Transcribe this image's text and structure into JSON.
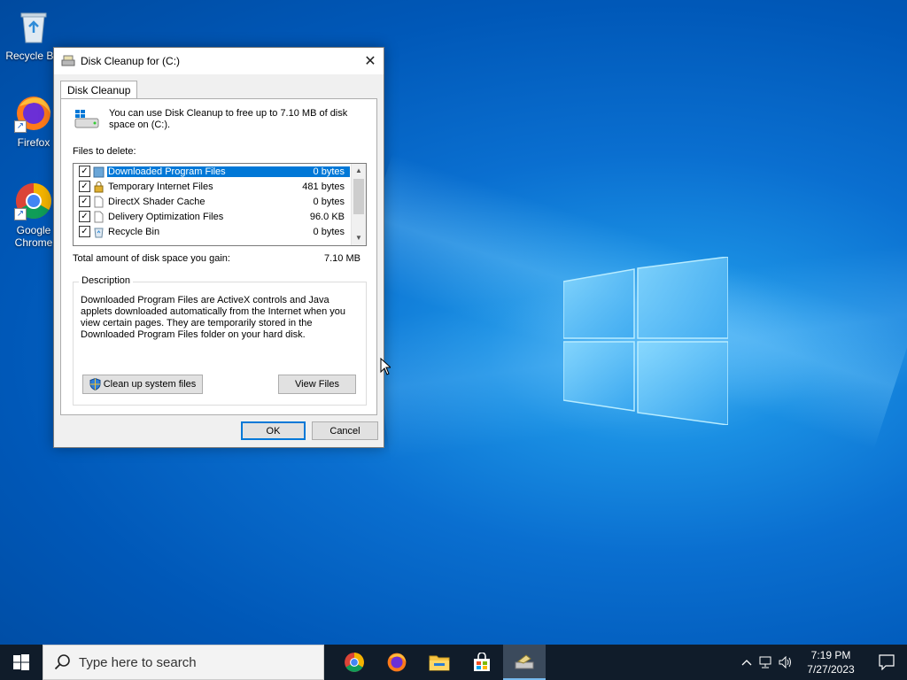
{
  "desktop": {
    "icons": [
      {
        "label": "Recycle Bin",
        "icon": "recycle-bin-icon"
      },
      {
        "label": "Firefox",
        "icon": "firefox-icon"
      },
      {
        "label": "Google Chrome",
        "icon": "chrome-icon"
      }
    ]
  },
  "dialog": {
    "title": "Disk Cleanup for  (C:)",
    "tab_label": "Disk Cleanup",
    "info_text": "You can use Disk Cleanup to free up to 7.10 MB of disk space on  (C:).",
    "files_label": "Files to delete:",
    "files": [
      {
        "name": "Downloaded Program Files",
        "size": "0 bytes",
        "checked": true,
        "selected": true
      },
      {
        "name": "Temporary Internet Files",
        "size": "481 bytes",
        "checked": true,
        "selected": false
      },
      {
        "name": "DirectX Shader Cache",
        "size": "0 bytes",
        "checked": true,
        "selected": false
      },
      {
        "name": "Delivery Optimization Files",
        "size": "96.0 KB",
        "checked": true,
        "selected": false
      },
      {
        "name": "Recycle Bin",
        "size": "0 bytes",
        "checked": true,
        "selected": false
      }
    ],
    "total_label": "Total amount of disk space you gain:",
    "total_value": "7.10 MB",
    "description_legend": "Description",
    "description_text": "Downloaded Program Files are ActiveX controls and Java applets downloaded automatically from the Internet when you view certain pages. They are temporarily stored in the Downloaded Program Files folder on your hard disk.",
    "cleanup_system_label": "Clean up system files",
    "view_files_label": "View Files",
    "ok_label": "OK",
    "cancel_label": "Cancel",
    "check_mark": "✓",
    "close_glyph": "✕"
  },
  "taskbar": {
    "search_placeholder": "Type here to search",
    "apps": [
      "chrome-icon",
      "firefox-icon",
      "file-explorer-icon",
      "store-icon",
      "disk-cleanup-icon"
    ],
    "time": "7:19 PM",
    "date": "7/27/2023",
    "tray_chevron": "^"
  },
  "colors": {
    "accent": "#0078d7",
    "taskbar": "#101c2a"
  }
}
